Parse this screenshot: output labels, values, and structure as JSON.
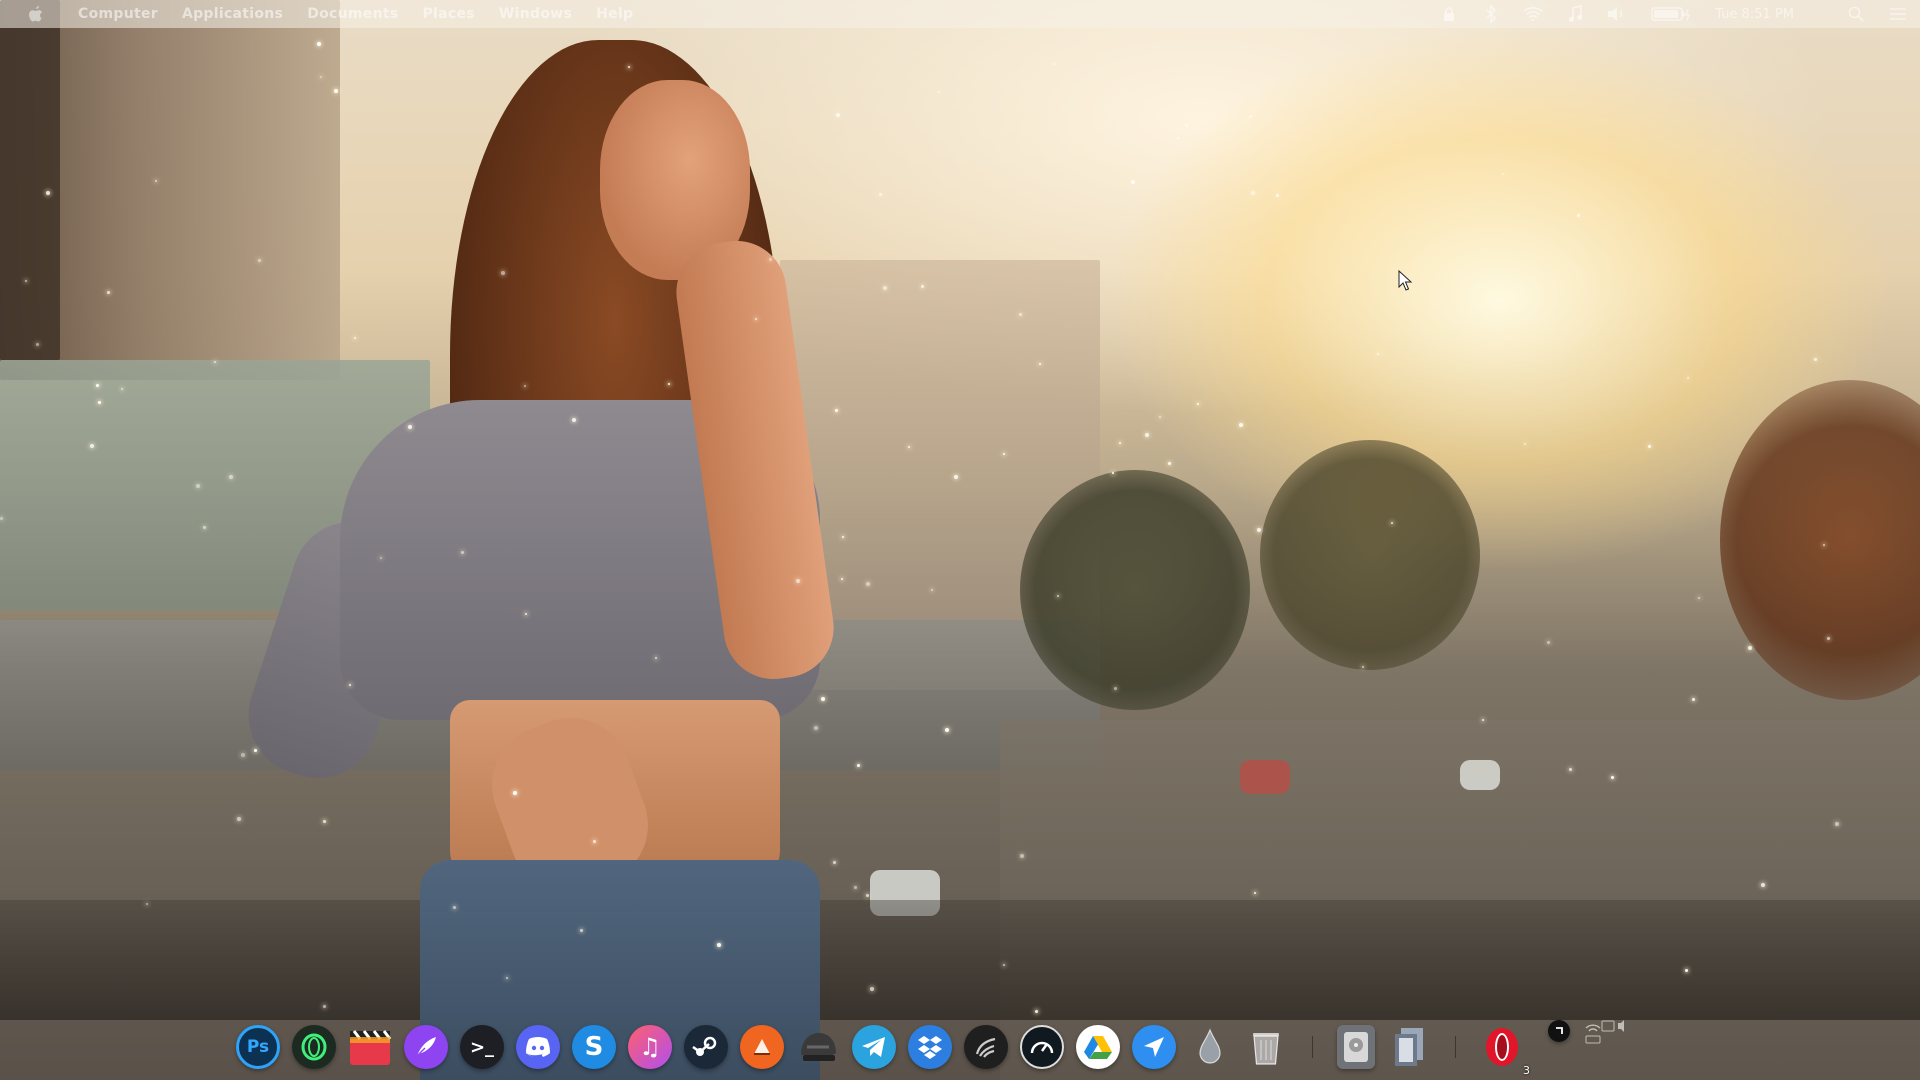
{
  "topbar": {
    "menu": [
      "Computer",
      "Applications",
      "Documents",
      "Places",
      "Windows",
      "Help"
    ],
    "clock": "Tue 8:51 PM",
    "status_icons": [
      "lock-icon",
      "bluetooth-icon",
      "wifi-icon",
      "music-icon",
      "volume-icon",
      "battery-icon",
      "search-icon",
      "menu-icon"
    ]
  },
  "dock": {
    "apps": [
      {
        "id": "photoshop",
        "glyph": "Ps",
        "color": "#0d3152"
      },
      {
        "id": "opera-gx",
        "glyph": "O",
        "color": "#1c2a22"
      },
      {
        "id": "final-cut",
        "glyph": "",
        "color": "#2a2a2a"
      },
      {
        "id": "quill",
        "glyph": "",
        "color": "#8e44f0"
      },
      {
        "id": "terminal",
        "glyph": ">_",
        "color": "#1d1f24"
      },
      {
        "id": "discord",
        "glyph": "",
        "color": "#5865f2"
      },
      {
        "id": "skype",
        "glyph": "S",
        "color": "#1f8be3"
      },
      {
        "id": "music",
        "glyph": "♫",
        "color": "#ff4aa2"
      },
      {
        "id": "steam",
        "glyph": "",
        "color": "#1b2838"
      },
      {
        "id": "vlc",
        "glyph": "",
        "color": "#f0651f"
      },
      {
        "id": "helmet",
        "glyph": "",
        "color": "#454545"
      },
      {
        "id": "telegram",
        "glyph": "",
        "color": "#2aa3de"
      },
      {
        "id": "dropbox",
        "glyph": "",
        "color": "#2c7fe0"
      },
      {
        "id": "kodi",
        "glyph": "",
        "color": "#1f1f1f"
      },
      {
        "id": "speedtest",
        "glyph": "",
        "color": "#101820"
      },
      {
        "id": "google-drive",
        "glyph": "",
        "color": "#ffffff"
      },
      {
        "id": "send",
        "glyph": "",
        "color": "#2f8ff0"
      },
      {
        "id": "water-drop",
        "glyph": "",
        "color": "transparent"
      },
      {
        "id": "trash",
        "glyph": "",
        "color": "transparent"
      }
    ],
    "opera_badge": "3"
  }
}
